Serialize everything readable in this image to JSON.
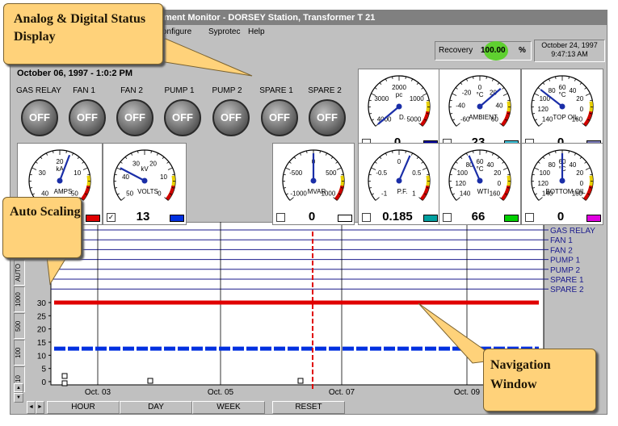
{
  "window": {
    "title": "ment Monitor - DORSEY Station, Transformer T 21",
    "menu": [
      "onfigure",
      "Syprotec",
      "Help"
    ]
  },
  "header": {
    "datetime": "October 06, 1997 - 1:0:2 PM",
    "recovery_label": "Recovery",
    "recovery_value": "100.00",
    "recovery_unit": "%",
    "clock_date": "October 24, 1997",
    "clock_time": "9:47:13 AM"
  },
  "status_buttons": [
    {
      "label": "GAS RELAY",
      "state": "OFF"
    },
    {
      "label": "FAN 1",
      "state": "OFF"
    },
    {
      "label": "FAN 2",
      "state": "OFF"
    },
    {
      "label": "PUMP 1",
      "state": "OFF"
    },
    {
      "label": "PUMP 2",
      "state": "OFF"
    },
    {
      "label": "SPARE 1",
      "state": "OFF"
    },
    {
      "label": "SPARE 2",
      "state": "OFF"
    }
  ],
  "gauges": [
    {
      "name": "pc-gauge",
      "unit": "pc",
      "label": "D.",
      "ticks": [
        "2000",
        "3000",
        "1000",
        "4000",
        "5000"
      ],
      "value": "0",
      "value_fraction": 0.0,
      "swatch": "#0000a0",
      "checked": false
    },
    {
      "name": "ambient-gauge",
      "unit": "°C",
      "label": "AMBIENT",
      "ticks": [
        "0",
        "-20",
        "20",
        "-40",
        "40",
        "-60",
        "60"
      ],
      "value": "23",
      "value_fraction": 0.69,
      "swatch": "#40c8e0",
      "checked": false
    },
    {
      "name": "top-oil-gauge",
      "unit": "°C",
      "label": "TOP OIL",
      "ticks": [
        "60",
        "80",
        "40",
        "100",
        "20",
        "120",
        "0",
        "140",
        "160"
      ],
      "value": "0",
      "value_fraction": 0.3,
      "swatch": "#8080c0",
      "checked": false
    },
    {
      "name": "amps-gauge",
      "unit": "kA",
      "label": "AMPS",
      "ticks": [
        "20",
        "30",
        "10",
        "40",
        "50"
      ],
      "value": "",
      "value_fraction": 0.58,
      "swatch": "#e00000",
      "checked": false
    },
    {
      "name": "volts-gauge",
      "unit": "kV",
      "label": "VOLTS",
      "ticks": [
        "20",
        "30",
        "10",
        "40",
        "0",
        "50"
      ],
      "value": "13",
      "value_fraction": 0.26,
      "swatch": "#0030e0",
      "checked": true
    },
    {
      "name": "mvar-gauge",
      "unit": "",
      "label": "MVAR",
      "ticks": [
        "0",
        "-500",
        "500",
        "-1000",
        "1000"
      ],
      "value": "0",
      "value_fraction": 0.5,
      "swatch": "#ffffff",
      "checked": false
    },
    {
      "name": "pf-gauge",
      "unit": "",
      "label": "P.F.",
      "ticks": [
        "0",
        "-0.5",
        "0.5",
        "-1",
        "1"
      ],
      "value": "0.185",
      "value_fraction": 0.59,
      "swatch": "#00a0a0",
      "checked": false
    },
    {
      "name": "wti-gauge",
      "unit": "°C",
      "label": "WTI",
      "ticks": [
        "60",
        "80",
        "40",
        "100",
        "20",
        "120",
        "0",
        "140",
        "160"
      ],
      "value": "66",
      "value_fraction": 0.41,
      "swatch": "#00d000",
      "checked": false
    },
    {
      "name": "bottom-oil-gauge",
      "unit": "°C",
      "label": "BOTTOM OIL",
      "ticks": [
        "60",
        "80",
        "40",
        "100",
        "20",
        "120",
        "0",
        "140",
        "160"
      ],
      "value": "0",
      "value_fraction": 0.5,
      "swatch": "#e000e0",
      "checked": false
    }
  ],
  "scale_buttons": [
    "AUTO",
    "1000",
    "500",
    "100",
    "10"
  ],
  "chart_data": {
    "type": "line",
    "x": [
      "Oct. 03",
      "Oct. 05",
      "Oct. 07",
      "Oct. 09"
    ],
    "yticks": [
      "30",
      "25",
      "20",
      "15",
      "10",
      "5",
      "0"
    ],
    "ylim": [
      0,
      30
    ],
    "digital_channels": [
      "GAS RELAY",
      "FAN 1",
      "FAN 2",
      "PUMP 1",
      "PUMP 2",
      "SPARE 1",
      "SPARE 2"
    ],
    "series": [
      {
        "color": "#e00000",
        "values": [
          30,
          30,
          30,
          30,
          30,
          30,
          30
        ]
      },
      {
        "color": "#0030e0",
        "values": [
          12.5,
          12.5,
          12.5,
          12.5,
          12.5,
          12.5,
          12.5
        ]
      }
    ],
    "cursor_date": "Oct. 06"
  },
  "nav_buttons": [
    "HOUR",
    "DAY",
    "WEEK",
    "RESET"
  ],
  "callouts": {
    "status": "Analog & Digital Status Display",
    "auto": "Auto Scaling",
    "nav": "Navigation Window"
  },
  "colors": {
    "window_bg": "#c0c0c0",
    "callout": "#ffd27a",
    "trace_red": "#e00000",
    "trace_blue": "#0030e0",
    "channel_line": "#1a1a8c"
  }
}
